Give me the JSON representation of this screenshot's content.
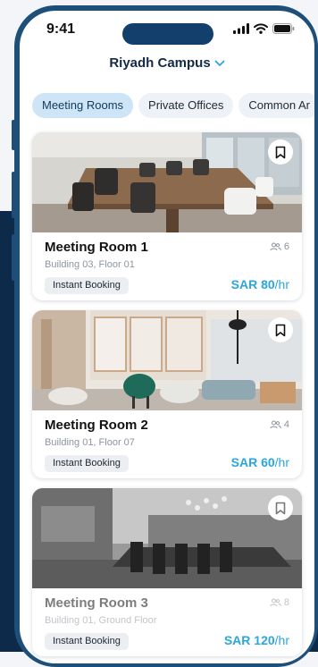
{
  "status_bar": {
    "time": "9:41"
  },
  "header": {
    "campus_label": "Riyadh Campus"
  },
  "tabs": [
    {
      "label": "Meeting Rooms",
      "active": true
    },
    {
      "label": "Private Offices",
      "active": false
    },
    {
      "label": "Common Ar",
      "active": false
    }
  ],
  "rooms": [
    {
      "name": "Meeting Room 1",
      "location": "Building 03, Floor 01",
      "capacity": "6",
      "badge": "Instant Booking",
      "price": "SAR 80",
      "unit": "/hr"
    },
    {
      "name": "Meeting Room 2",
      "location": "Building 01, Floor 07",
      "capacity": "4",
      "badge": "Instant Booking",
      "price": "SAR 60",
      "unit": "/hr"
    },
    {
      "name": "Meeting Room 3",
      "location": "Building 01, Ground Floor",
      "capacity": "8",
      "badge": "Instant Booking",
      "price": "SAR 120",
      "unit": "/hr"
    }
  ],
  "colors": {
    "accent": "#2aa6de",
    "phone_frame": "#1e4f79",
    "active_tab": "#cde5f6"
  },
  "icons": [
    "signal-icon",
    "wifi-icon",
    "battery-icon",
    "chevron-down-icon",
    "bookmark-icon",
    "people-icon"
  ]
}
